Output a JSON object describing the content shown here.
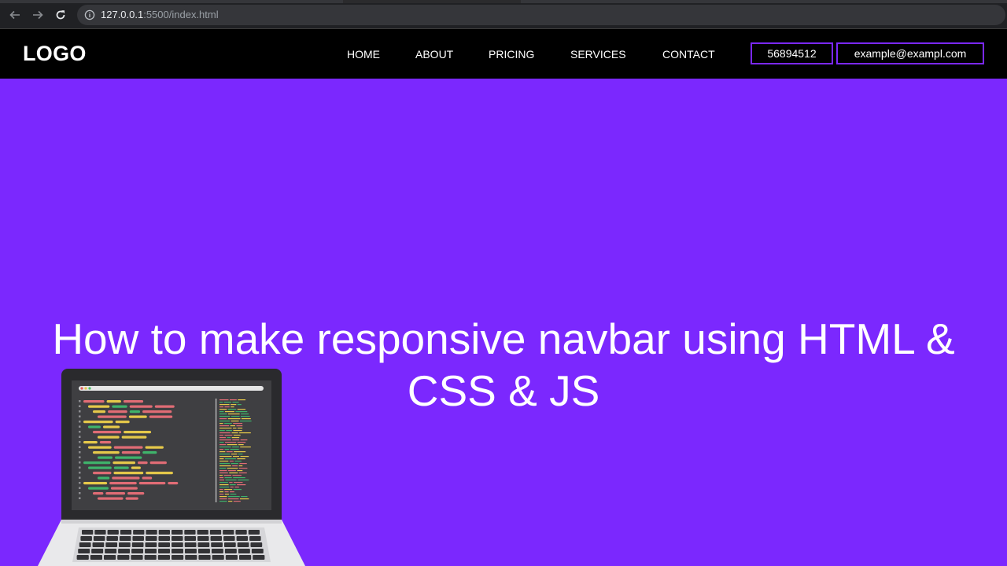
{
  "browser": {
    "url_host": "127.0.0.1",
    "url_rest": ":5500/index.html",
    "icons": [
      "back-arrow-icon",
      "forward-arrow-icon",
      "reload-icon",
      "info-icon"
    ]
  },
  "navbar": {
    "logo": "LOGO",
    "links": [
      {
        "label": "HOME"
      },
      {
        "label": "ABOUT"
      },
      {
        "label": "PRICING"
      },
      {
        "label": "SERVICES"
      },
      {
        "label": "CONTACT"
      }
    ],
    "phone": "56894512",
    "email": "example@exampl.com"
  },
  "hero": {
    "title_line1": "How to make responsive navbar using HTML &",
    "title_line2": "CSS & JS",
    "illustration": "laptop-code-illustration"
  },
  "colors": {
    "accent": "#7b28fe",
    "navbar_bg": "#000000",
    "text": "#ffffff"
  }
}
